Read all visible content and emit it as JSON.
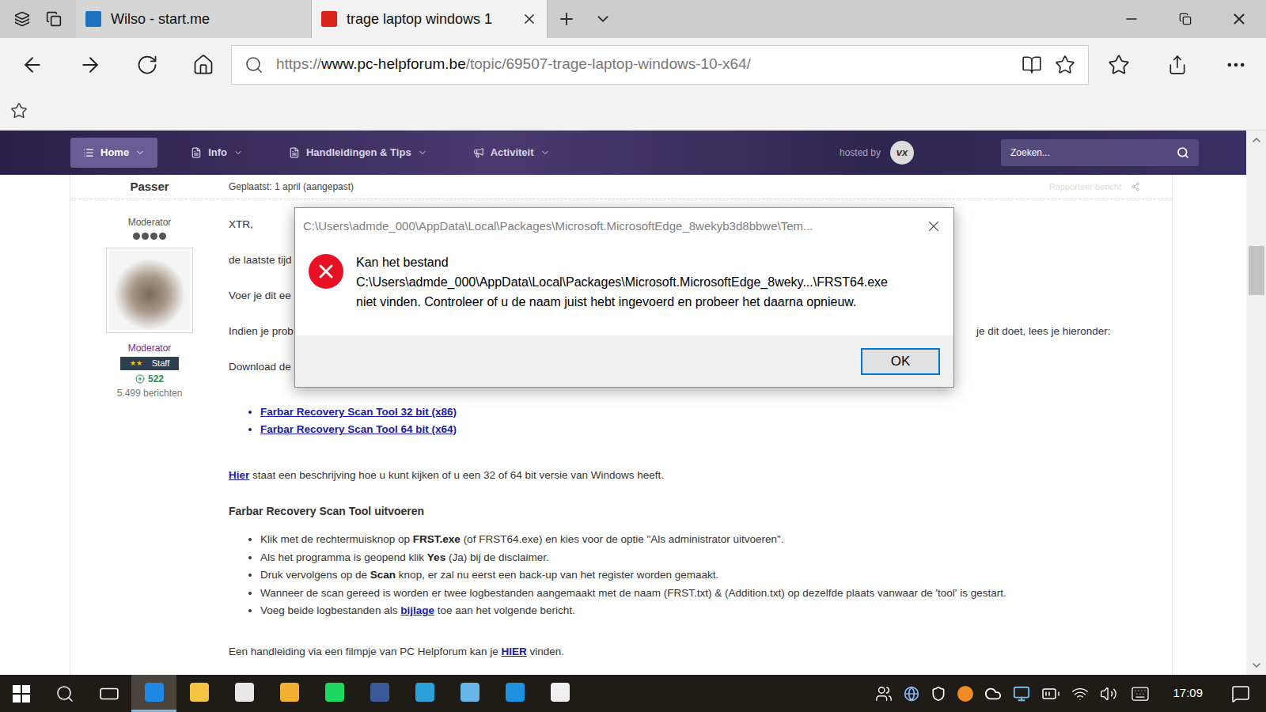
{
  "browser": {
    "tabs": [
      {
        "title": "Wilso - start.me",
        "selected": false,
        "color": "#1e73be"
      },
      {
        "title": "trage laptop windows 1",
        "selected": true,
        "color": "#d9261c"
      }
    ],
    "address": {
      "scheme": "https://",
      "host": "www.pc-helpforum.be",
      "path": "/topic/69507-trage-laptop-windows-10-x64/"
    }
  },
  "site_nav": {
    "items": [
      {
        "label": "Home",
        "selected": true
      },
      {
        "label": "Info",
        "selected": false
      },
      {
        "label": "Handleidingen & Tips",
        "selected": false
      },
      {
        "label": "Activiteit",
        "selected": false
      }
    ],
    "hosted_by": "hosted by",
    "logo_text": "vx",
    "search_placeholder": "Zoeken..."
  },
  "post": {
    "author": "Passer",
    "posted": "Geplaatst: 1 april (aangepast)",
    "report": "Rapporteer bericht",
    "role": "Moderator",
    "rank_pips": 4,
    "group": "Moderator",
    "badge": {
      "stars_text": "★★",
      "label": "Staff"
    },
    "reputation": "522",
    "post_count": "5.499 berichten",
    "intro": [
      {
        "left": "XTR,",
        "right": ""
      },
      {
        "left": "de laatste tijd",
        "right": ""
      },
      {
        "left": "Voer je dit ee",
        "right": ""
      },
      {
        "left": "Indien je prob",
        "right": "je dit doet, lees je hieronder:"
      },
      {
        "left": "Download de",
        "right": ""
      }
    ],
    "downloads": [
      "Farbar Recovery Scan Tool 32 bit (x86)",
      "Farbar Recovery Scan Tool 64 bit (x64)"
    ],
    "hint": [
      {
        "kind": "link",
        "text": "Hier"
      },
      {
        "kind": "text",
        "text": " staat een beschrijving hoe u kunt kijken of u een 32 of 64 bit versie van Windows heeft."
      }
    ],
    "heading": "Farbar Recovery Scan Tool uitvoeren",
    "steps": [
      [
        {
          "kind": "text",
          "text": "Klik met de rechtermuisknop op "
        },
        {
          "kind": "bold",
          "text": "FRST.exe"
        },
        {
          "kind": "text",
          "text": " (of FRST64.exe) en kies voor de optie \"Als administrator uitvoeren\"."
        }
      ],
      [
        {
          "kind": "text",
          "text": "Als het programma is geopend klik "
        },
        {
          "kind": "bold",
          "text": "Yes"
        },
        {
          "kind": "text",
          "text": " (Ja) bij de disclaimer."
        }
      ],
      [
        {
          "kind": "text",
          "text": "Druk vervolgens op de "
        },
        {
          "kind": "bold",
          "text": "Scan"
        },
        {
          "kind": "text",
          "text": " knop, er zal nu eerst een back-up van het register worden gemaakt."
        }
      ],
      [
        {
          "kind": "text",
          "text": "Wanneer de scan gereed is worden er twee logbestanden aangemaakt met de naam (FRST.txt) & (Addition.txt) op dezelfde plaats vanwaar de 'tool' is gestart."
        }
      ],
      [
        {
          "kind": "text",
          "text": "Voeg beide logbestanden als "
        },
        {
          "kind": "link",
          "text": "bijlage"
        },
        {
          "kind": "text",
          "text": " toe aan het volgende bericht."
        }
      ]
    ],
    "footer": [
      {
        "kind": "text",
        "text": "Een handleiding via een filmpje van PC Helpforum kan je "
      },
      {
        "kind": "link",
        "text": "HIER"
      },
      {
        "kind": "text",
        "text": " vinden."
      }
    ]
  },
  "dialog": {
    "title": "C:\\Users\\admde_000\\AppData\\Local\\Packages\\Microsoft.MicrosoftEdge_8wekyb3d8bbwe\\Tem...",
    "message": [
      "Kan het bestand",
      "C:\\Users\\admde_000\\AppData\\Local\\Packages\\Microsoft.MicrosoftEdge_8weky...\\FRST64.exe",
      "niet vinden. Controleer of u de naam juist hebt ingevoerd en probeer het daarna opnieuw."
    ],
    "buttons": [
      "OK"
    ]
  },
  "taskbar": {
    "apps": [
      {
        "active": true,
        "color": "#1e88e5"
      },
      {
        "active": false,
        "color": "#f4c542"
      },
      {
        "active": false,
        "color": "#e8e8e8"
      },
      {
        "active": false,
        "color": "#f2b134"
      },
      {
        "active": false,
        "color": "#1ed760"
      },
      {
        "active": false,
        "color": "#3b5998"
      },
      {
        "active": false,
        "color": "#2a9fd8"
      },
      {
        "active": false,
        "color": "#68b5e8"
      },
      {
        "active": false,
        "color": "#1f8fe0"
      },
      {
        "active": false,
        "color": "#f0f0f0"
      }
    ],
    "clock": "17:09"
  }
}
